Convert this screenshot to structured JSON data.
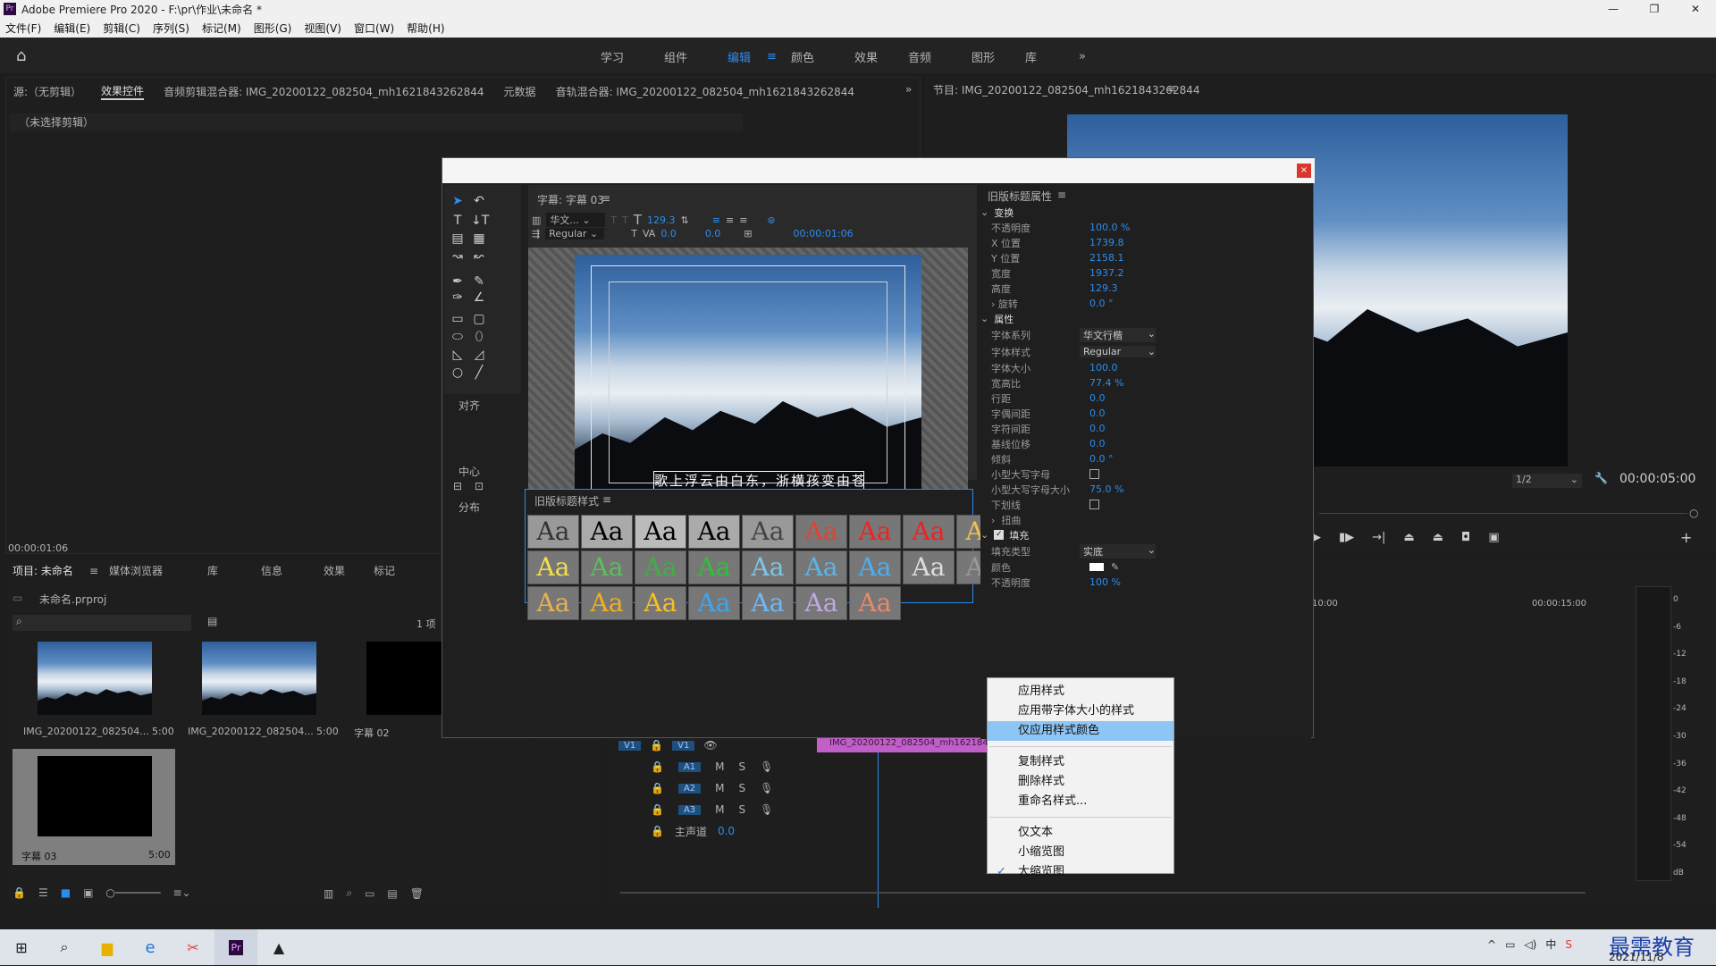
{
  "window": {
    "title": "Adobe Premiere Pro 2020 - F:\\pr\\作业\\未命名 *",
    "controls": [
      "—",
      "❐",
      "✕"
    ]
  },
  "menubar": [
    "文件(F)",
    "编辑(E)",
    "剪辑(C)",
    "序列(S)",
    "标记(M)",
    "图形(G)",
    "视图(V)",
    "窗口(W)",
    "帮助(H)"
  ],
  "workspaces": [
    "学习",
    "组件",
    "编辑",
    "颜色",
    "效果",
    "音频",
    "图形",
    "库"
  ],
  "workspace_active": "编辑",
  "source_tabs": [
    "源:（无剪辑）",
    "效果控件",
    "音频剪辑混合器: IMG_20200122_082504_mh1621843262844",
    "元数据",
    "音轨混合器: IMG_20200122_082504_mh1621843262844"
  ],
  "no_clip": "（未选择剪辑）",
  "src_timecode": "00:00:01:06",
  "program": {
    "title": "节目: IMG_20200122_082504_mh1621843262844",
    "zoom": "1/2",
    "timecode": "00:00:05:00"
  },
  "project": {
    "tabs": [
      "项目: 未命名",
      "媒体浏览器",
      "库",
      "信息",
      "效果",
      "标记"
    ],
    "file": "未命名.prproj",
    "count": "1 项",
    "items": [
      {
        "name": "IMG_20200122_082504...",
        "dur": "5:00"
      },
      {
        "name": "IMG_20200122_082504...",
        "dur": "5:00"
      },
      {
        "name": "字幕 02",
        "dur": ""
      },
      {
        "name": "字幕 03",
        "dur": "5:00"
      }
    ]
  },
  "title_editor": {
    "panel_title": "字幕: 字幕 03",
    "font": "华文...",
    "style": "Regular",
    "size": "129.3",
    "kern": "0.0",
    "lead": "0.0",
    "time": "00:00:01:06",
    "caption": "歌上浮云由白东，浙横孩变由苍狗",
    "align_label": "对齐",
    "center_label": "中心",
    "dist_label": "分布",
    "styles_title": "旧版标题样式",
    "swatch_text": "Aa"
  },
  "props": {
    "title": "旧版标题属性",
    "sections": {
      "transform": "变换",
      "attrs": "属性",
      "fill": "填充"
    },
    "transform": [
      [
        "不透明度",
        "100.0 %"
      ],
      [
        "X 位置",
        "1739.8"
      ],
      [
        "Y 位置",
        "2158.1"
      ],
      [
        "宽度",
        "1937.2"
      ],
      [
        "高度",
        "129.3"
      ],
      [
        "旋转",
        "0.0 °"
      ]
    ],
    "attrs_select": [
      [
        "字体系列",
        "华文行楷"
      ],
      [
        "字体样式",
        "Regular"
      ]
    ],
    "attrs": [
      [
        "字体大小",
        "100.0"
      ],
      [
        "宽高比",
        "77.4 %"
      ],
      [
        "行距",
        "0.0"
      ],
      [
        "字偶间距",
        "0.0"
      ],
      [
        "字符间距",
        "0.0"
      ],
      [
        "基线位移",
        "0.0"
      ],
      [
        "倾斜",
        "0.0 °"
      ]
    ],
    "smallcaps": "小型大写字母",
    "smallcaps_size": "小型大写字母大小",
    "smallcaps_size_val": "75.0 %",
    "underline": "下划线",
    "distort": "扭曲",
    "fill_type": "填充类型",
    "fill_type_val": "实底",
    "color": "颜色",
    "opacity": "不透明度",
    "opacity_val": "100 %"
  },
  "context_menu": {
    "items": [
      "应用样式",
      "应用带字体大小的样式",
      "仅应用样式颜色",
      "复制样式",
      "删除样式",
      "重命名样式...",
      "仅文本",
      "小缩览图",
      "大缩览图"
    ],
    "highlighted": "仅应用样式颜色",
    "checked": "大缩览图"
  },
  "timeline": {
    "tracks": [
      "V1",
      "A1",
      "A2",
      "A3"
    ],
    "master": "主声道",
    "master_val": "0.0",
    "t1": "10:00",
    "t2": "00:00:15:00",
    "clip": "IMG_20200122_082504_mh1621843262844"
  },
  "meter": [
    "0",
    "-6",
    "-12",
    "-18",
    "-24",
    "-30",
    "-36",
    "-42",
    "-48",
    "-54",
    "dB"
  ],
  "taskbar": {
    "date": "2021/11/8",
    "watermark": "最需教育",
    "ime": "中"
  }
}
